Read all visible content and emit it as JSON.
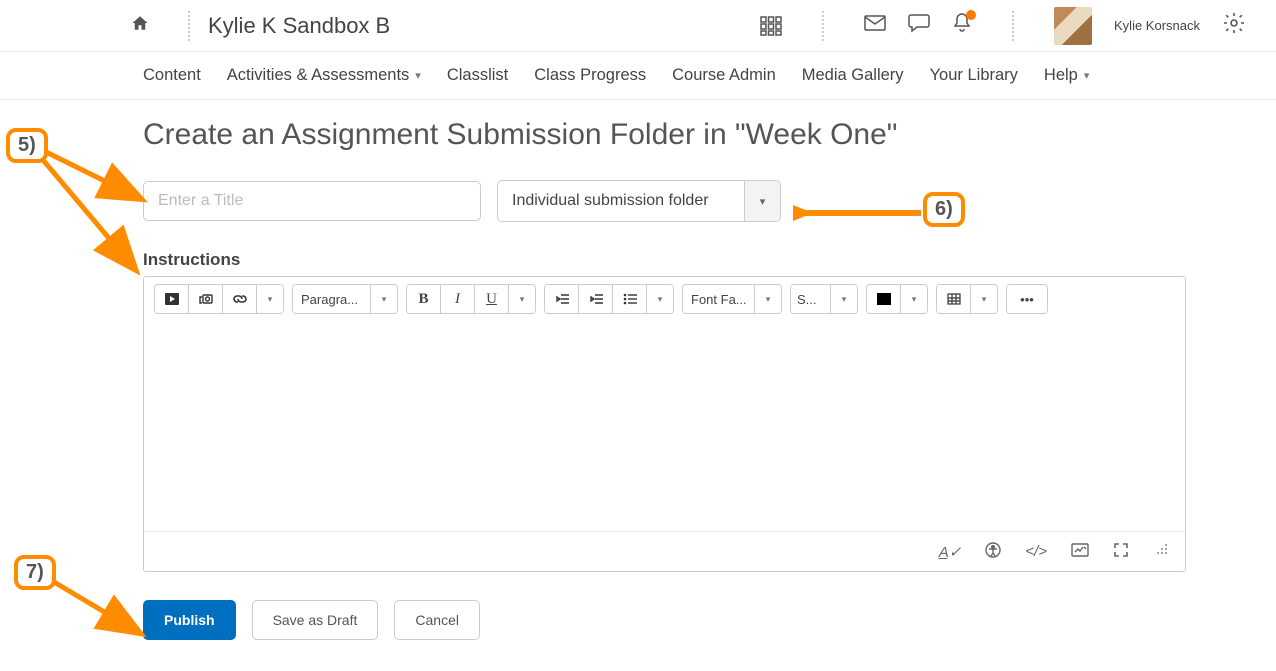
{
  "topbar": {
    "course_title": "Kylie K Sandbox B",
    "username": "Kylie Korsnack"
  },
  "nav": {
    "items": [
      "Content",
      "Activities & Assessments",
      "Classlist",
      "Class Progress",
      "Course Admin",
      "Media Gallery",
      "Your Library",
      "Help"
    ],
    "dropdown_indices": [
      1,
      7
    ]
  },
  "page": {
    "title": "Create an Assignment Submission Folder in \"Week One\"",
    "title_placeholder": "Enter a Title",
    "folder_type": "Individual submission folder",
    "instructions_label": "Instructions"
  },
  "editor": {
    "paragraph": "Paragra...",
    "font_family": "Font Fa...",
    "size": "S..."
  },
  "actions": {
    "publish": "Publish",
    "save_draft": "Save as Draft",
    "cancel": "Cancel"
  },
  "callouts": {
    "c5": "5)",
    "c6": "6)",
    "c7": "7)"
  }
}
